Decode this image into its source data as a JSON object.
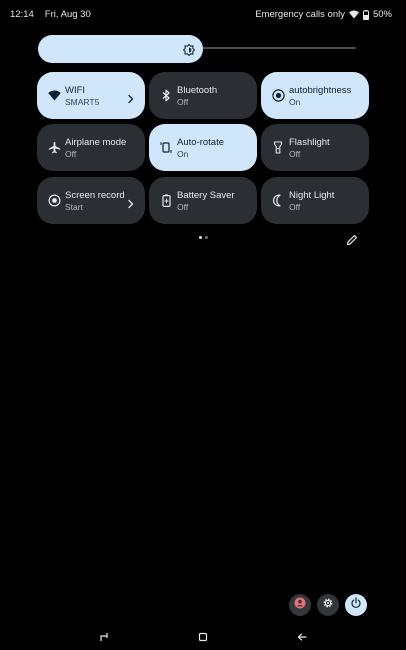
{
  "status_bar": {
    "time": "12:14",
    "date": "Fri, Aug 30",
    "carrier_text": "Emergency calls only",
    "battery": "50%"
  },
  "brightness": {
    "level": 0.52,
    "icon": "brightness-icon"
  },
  "tiles": [
    {
      "label": "WIFI",
      "sub": "SMART5",
      "on": true,
      "icon": "wifi-icon",
      "chevron": true
    },
    {
      "label": "Bluetooth",
      "sub": "Off",
      "on": false,
      "icon": "bluetooth-icon",
      "chevron": false
    },
    {
      "label": "autobrightness",
      "sub": "On",
      "on": true,
      "icon": "auto-brightness-icon",
      "chevron": false
    },
    {
      "label": "Airplane mode",
      "sub": "Off",
      "on": false,
      "icon": "airplane-icon",
      "chevron": false
    },
    {
      "label": "Auto-rotate",
      "sub": "On",
      "on": true,
      "icon": "rotate-icon",
      "chevron": false
    },
    {
      "label": "Flashlight",
      "sub": "Off",
      "on": false,
      "icon": "flashlight-icon",
      "chevron": false
    },
    {
      "label": "Screen record",
      "sub": "Start",
      "on": false,
      "icon": "screen-record-icon",
      "chevron": true
    },
    {
      "label": "Battery Saver",
      "sub": "Off",
      "on": false,
      "icon": "battery-saver-icon",
      "chevron": false
    },
    {
      "label": "Night Light",
      "sub": "Off",
      "on": false,
      "icon": "night-light-icon",
      "chevron": false
    }
  ],
  "pager": {
    "pages": 2,
    "active": 0
  },
  "colors": {
    "tile_on": "#cfe6fb",
    "tile_off": "#2b2e33",
    "background": "#000000",
    "user_icon": "#e57373"
  }
}
